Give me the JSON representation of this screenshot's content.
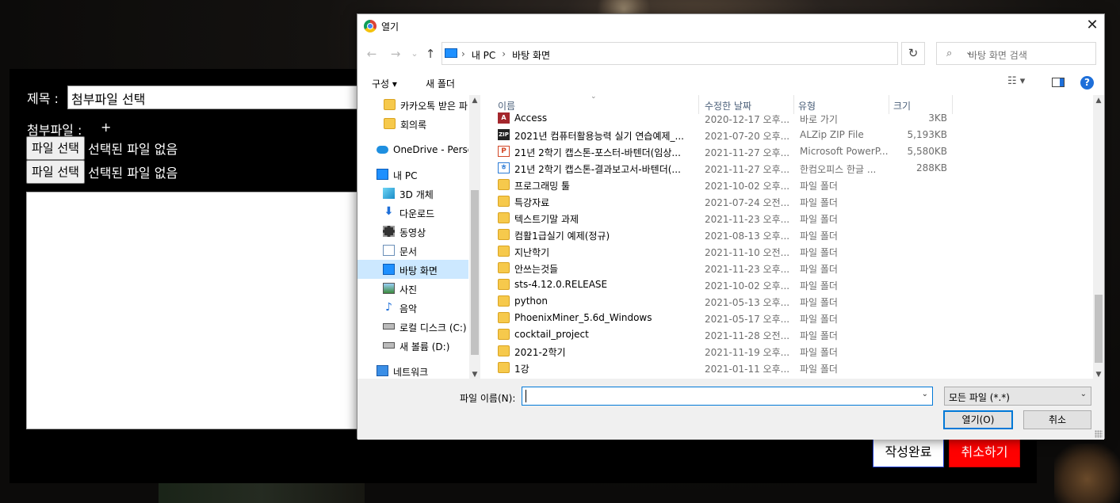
{
  "form": {
    "title_label": "제목 :",
    "title_value": "첨부파일 선택",
    "attach_label": "첨부파일 :",
    "attach_plus": "+",
    "file_inputs": [
      {
        "button": "파일 선택",
        "status": "선택된 파일 없음"
      },
      {
        "button": "파일 선택",
        "status": "선택된 파일 없음"
      }
    ],
    "submit": "작성완료",
    "cancel": "취소하기"
  },
  "dialog": {
    "title": "열기",
    "close": "✕",
    "nav": {
      "back": "←",
      "forward": "→",
      "recent": "⌄",
      "up": "↑"
    },
    "address": {
      "parts": [
        "내 PC",
        "바탕 화면"
      ],
      "separator": "›",
      "dropdown": "⌄",
      "refresh": "↻"
    },
    "search_placeholder": "바탕 화면 검색",
    "toolbar": {
      "organize": "구성 ▾",
      "new_folder": "새 폴더",
      "view": "☷ ▾",
      "help": "?"
    },
    "nav_items": [
      {
        "label": "카카오톡 받은 파",
        "icon": "folder-icon"
      },
      {
        "label": "회의록",
        "icon": "folder-icon"
      },
      {
        "label": "OneDrive - Person",
        "icon": "onedrive-icon"
      },
      {
        "label": "내 PC",
        "icon": "pc-icon"
      },
      {
        "label": "3D 개체",
        "icon": "3d-objects-icon"
      },
      {
        "label": "다운로드",
        "icon": "download-icon"
      },
      {
        "label": "동영상",
        "icon": "video-icon"
      },
      {
        "label": "문서",
        "icon": "document-icon"
      },
      {
        "label": "바탕 화면",
        "icon": "desktop-icon"
      },
      {
        "label": "사진",
        "icon": "pictures-icon"
      },
      {
        "label": "음악",
        "icon": "music-icon"
      },
      {
        "label": "로컬 디스크 (C:)",
        "icon": "drive-icon"
      },
      {
        "label": "새 볼륨 (D:)",
        "icon": "drive-icon"
      },
      {
        "label": "네트워크",
        "icon": "network-icon"
      }
    ],
    "columns": {
      "name": "이름",
      "date": "수정한 날짜",
      "type": "유형",
      "size": "크기"
    },
    "files": [
      {
        "name": "Access",
        "date": "2020-12-17 오후...",
        "type": "바로 가기",
        "size": "3KB",
        "icon": "access-icon"
      },
      {
        "name": "2021년 컴퓨터활용능력 실기 연습예제_...",
        "date": "2021-07-20 오후...",
        "type": "ALZip ZIP File",
        "size": "5,193KB",
        "icon": "zip-icon"
      },
      {
        "name": "21년 2학기 캡스톤-포스터-바텐더(임상...",
        "date": "2021-11-27 오후...",
        "type": "Microsoft PowerP...",
        "size": "5,580KB",
        "icon": "powerpoint-icon"
      },
      {
        "name": "21년 2학기 캡스톤-결과보고서-바텐더(...",
        "date": "2021-11-27 오후...",
        "type": "한컴오피스 한글 ...",
        "size": "288KB",
        "icon": "hwp-icon"
      },
      {
        "name": "프로그래밍 툴",
        "date": "2021-10-02 오후...",
        "type": "파일 폴더",
        "size": "",
        "icon": "folder-icon"
      },
      {
        "name": "특강자료",
        "date": "2021-07-24 오전...",
        "type": "파일 폴더",
        "size": "",
        "icon": "folder-icon"
      },
      {
        "name": "텍스트기말 과제",
        "date": "2021-11-23 오후...",
        "type": "파일 폴더",
        "size": "",
        "icon": "folder-icon"
      },
      {
        "name": "컴활1급실기 예제(정규)",
        "date": "2021-08-13 오후...",
        "type": "파일 폴더",
        "size": "",
        "icon": "folder-icon"
      },
      {
        "name": "지난학기",
        "date": "2021-11-10 오전...",
        "type": "파일 폴더",
        "size": "",
        "icon": "folder-icon"
      },
      {
        "name": "안쓰는것들",
        "date": "2021-11-23 오후...",
        "type": "파일 폴더",
        "size": "",
        "icon": "folder-icon"
      },
      {
        "name": "sts-4.12.0.RELEASE",
        "date": "2021-10-02 오후...",
        "type": "파일 폴더",
        "size": "",
        "icon": "folder-icon"
      },
      {
        "name": "python",
        "date": "2021-05-13 오후...",
        "type": "파일 폴더",
        "size": "",
        "icon": "folder-icon"
      },
      {
        "name": "PhoenixMiner_5.6d_Windows",
        "date": "2021-05-17 오후...",
        "type": "파일 폴더",
        "size": "",
        "icon": "folder-icon"
      },
      {
        "name": "cocktail_project",
        "date": "2021-11-28 오전...",
        "type": "파일 폴더",
        "size": "",
        "icon": "folder-icon"
      },
      {
        "name": "2021-2학기",
        "date": "2021-11-19 오후...",
        "type": "파일 폴더",
        "size": "",
        "icon": "folder-icon"
      },
      {
        "name": "1강",
        "date": "2021-01-11 오후...",
        "type": "파일 폴더",
        "size": "",
        "icon": "folder-icon"
      }
    ],
    "filename_label": "파일 이름(N):",
    "filename_value": "",
    "filetype": "모든 파일 (*.*)",
    "open": "열기(O)",
    "cancel": "취소",
    "colors": {
      "accent": "#0078d7",
      "selected": "#cce8ff",
      "submit_border": "#1a3fd8",
      "cancel_bg": "#ff0000"
    }
  }
}
